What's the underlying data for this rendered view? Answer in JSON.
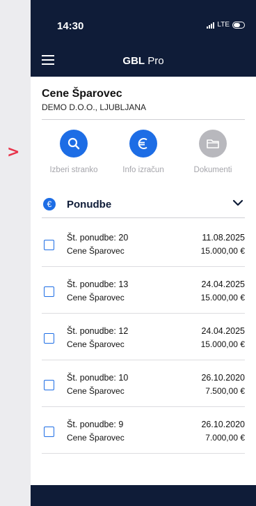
{
  "status": {
    "time": "14:30",
    "network": "LTE"
  },
  "header": {
    "title_bold": "GBL",
    "title_rest": " Pro"
  },
  "client": {
    "name": "Cene Šparovec",
    "company": "DEMO D.O.O., LJUBLJANA"
  },
  "actions": [
    {
      "label": "Izberi stranko",
      "icon": "search-icon"
    },
    {
      "label": "Info izračun",
      "icon": "euro-icon"
    },
    {
      "label": "Dokumenti",
      "icon": "folder-icon"
    }
  ],
  "section": {
    "title": "Ponudbe"
  },
  "offers": [
    {
      "number": "Št. ponudbe: 20",
      "customer": "Cene Šparovec",
      "date": "11.08.2025",
      "amount": "15.000,00 €"
    },
    {
      "number": "Št. ponudbe: 13",
      "customer": "Cene Šparovec",
      "date": "24.04.2025",
      "amount": "15.000,00 €"
    },
    {
      "number": "Št. ponudbe: 12",
      "customer": "Cene Šparovec",
      "date": "24.04.2025",
      "amount": "15.000,00 €"
    },
    {
      "number": "Št. ponudbe: 10",
      "customer": "Cene Šparovec",
      "date": "26.10.2020",
      "amount": "7.500,00 €"
    },
    {
      "number": "Št. ponudbe: 9",
      "customer": "Cene Šparovec",
      "date": "26.10.2020",
      "amount": "7.000,00 €"
    }
  ],
  "colors": {
    "navy": "#0f1c38",
    "accent": "#1d6de5",
    "pointer": "#e8334a",
    "disabled": "#b8b8bd"
  }
}
